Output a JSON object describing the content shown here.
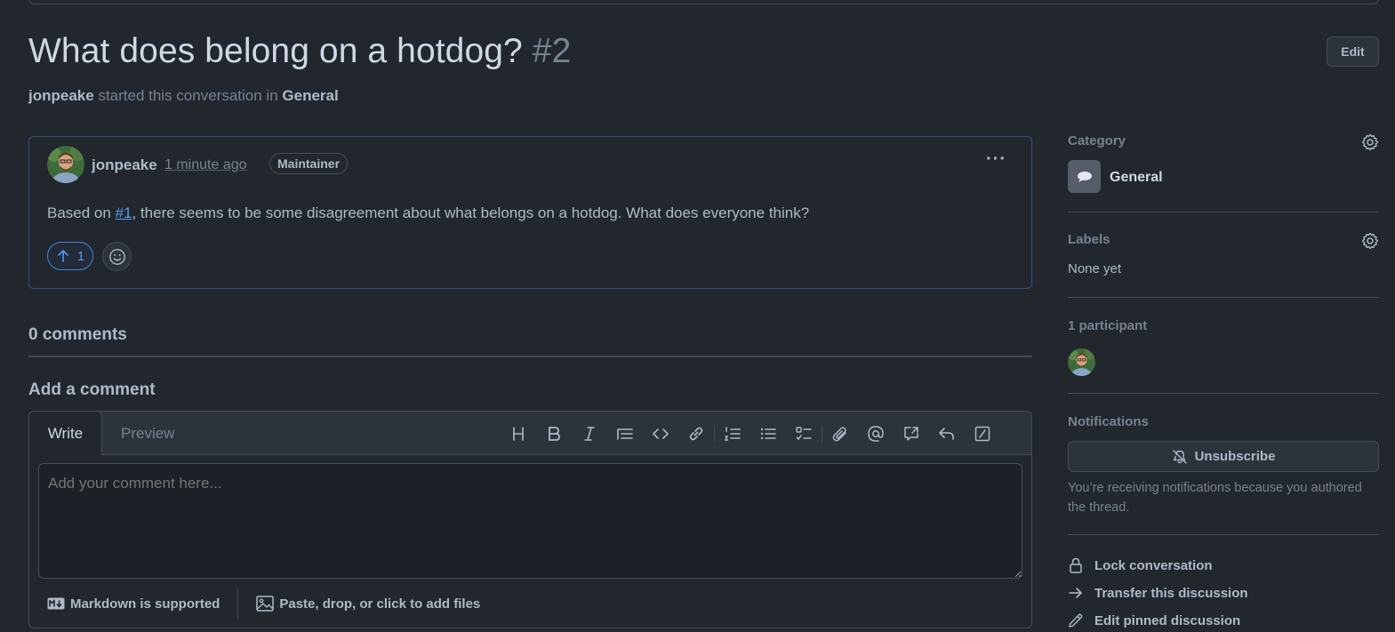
{
  "discussion": {
    "title": "What does belong on a hotdog?",
    "number": "#2",
    "edit_label": "Edit",
    "author": "jonpeake",
    "started_text": "started this conversation in",
    "category": "General"
  },
  "post": {
    "author": "jonpeake",
    "time": "1 minute ago",
    "badge": "Maintainer",
    "body_before": "Based on ",
    "body_link": "#1",
    "body_after": ", there seems to be some disagreement about what belongs on a hotdog. What does everyone think?",
    "upvotes": "1"
  },
  "comments": {
    "count_label": "0 comments",
    "add_label": "Add a comment"
  },
  "editor": {
    "tab_write": "Write",
    "tab_preview": "Preview",
    "placeholder": "Add your comment here...",
    "markdown_label": "Markdown is supported",
    "files_label": "Paste, drop, or click to add files",
    "toolbar_icons": [
      "heading-icon",
      "bold-icon",
      "italic-icon",
      "quote-icon",
      "code-icon",
      "link-icon",
      "ordered-list-icon",
      "unordered-list-icon",
      "task-list-icon",
      "attach-icon",
      "mention-icon",
      "reference-icon",
      "reply-icon",
      "slash-command-icon"
    ]
  },
  "sidebar": {
    "category_label": "Category",
    "category_value": "General",
    "labels_label": "Labels",
    "labels_value": "None yet",
    "participants_label": "1 participant",
    "notifications_label": "Notifications",
    "unsubscribe_label": "Unsubscribe",
    "notif_reason": "You’re receiving notifications because you authored the thread.",
    "actions": {
      "lock": "Lock conversation",
      "transfer": "Transfer this discussion",
      "edit_pinned": "Edit pinned discussion"
    }
  },
  "colors": {
    "background": "#22272e",
    "accent": "#539bf5",
    "border": "#444c56"
  }
}
